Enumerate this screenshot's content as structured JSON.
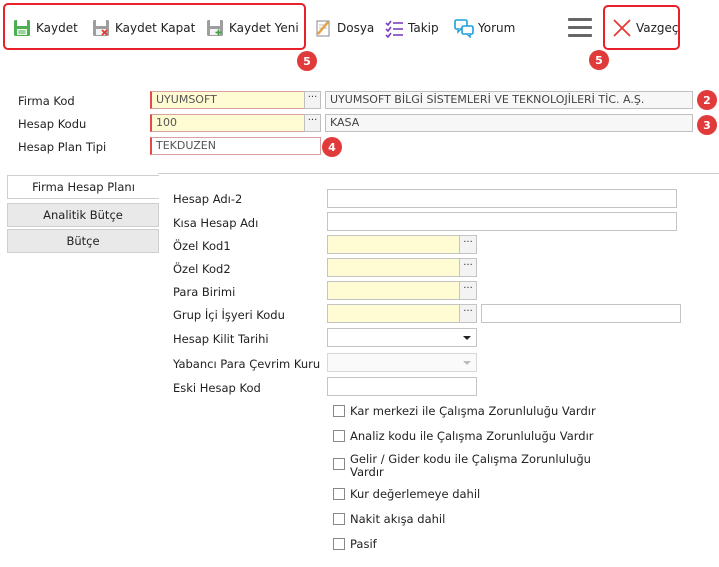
{
  "toolbar": {
    "save_label": "Kaydet",
    "save_close_label": "Kaydet Kapat",
    "save_new_label": "Kaydet Yeni",
    "file_label": "Dosya",
    "follow_label": "Takip",
    "comment_label": "Yorum",
    "cancel_label": "Vazgeç",
    "badge_left": "5",
    "badge_right": "5"
  },
  "header": {
    "firma_kod_label": "Firma Kod",
    "firma_kod_value": "UYUMSOFT",
    "firma_name_value": "UYUMSOFT BİLGİ SİSTEMLERİ VE TEKNOLOJİLERİ TİC. A.Ş.",
    "hesap_kodu_label": "Hesap Kodu",
    "hesap_kodu_value": "100",
    "hesap_name_value": "KASA",
    "hesap_plan_tipi_label": "Hesap Plan Tipi",
    "hesap_plan_tipi_value": "TEKDUZEN",
    "badge_2": "2",
    "badge_3": "3",
    "badge_4": "4",
    "lookup_glyph": "···"
  },
  "tabs": [
    {
      "label": "Firma Hesap Planı",
      "active": true
    },
    {
      "label": "Analitik Bütçe",
      "active": false
    },
    {
      "label": "Bütçe",
      "active": false
    }
  ],
  "detail": {
    "hesap_adi_2_label": "Hesap Adı-2",
    "kisa_hesap_adi_label": "Kısa Hesap Adı",
    "ozel_kod1_label": "Özel Kod1",
    "ozel_kod2_label": "Özel Kod2",
    "para_birimi_label": "Para Birimi",
    "grup_ici_label": "Grup İçi İşyeri Kodu",
    "hesap_kilit_label": "Hesap Kilit Tarihi",
    "yabanci_para_label": "Yabancı Para Çevrim Kuru",
    "eski_hesap_label": "Eski Hesap Kod"
  },
  "checkboxes": [
    {
      "label": "Kar merkezi ile Çalışma Zorunluluğu Vardır",
      "checked": false
    },
    {
      "label": "Analiz kodu ile Çalışma Zorunluluğu Vardır",
      "checked": false
    },
    {
      "label": "Gelir / Gider kodu ile Çalışma Zorunluluğu Vardır",
      "checked": false
    },
    {
      "label": "Kur değerlemeye dahil",
      "checked": false
    },
    {
      "label": "Nakit akışa dahil",
      "checked": false
    },
    {
      "label": "Pasif",
      "checked": false
    }
  ],
  "colors": {
    "highlight_red": "#e8202a",
    "badge_red": "#e13a3a",
    "field_yellow": "#fffbd2"
  }
}
